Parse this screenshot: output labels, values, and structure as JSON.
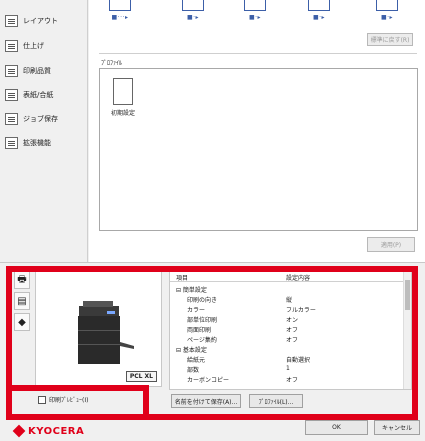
{
  "sidebar": {
    "items": [
      {
        "label": "レイアウト",
        "icon": "layout-icon"
      },
      {
        "label": "仕上げ",
        "icon": "finishing-icon"
      },
      {
        "label": "印刷品質",
        "icon": "print-quality-icon"
      },
      {
        "label": "表紙/合紙",
        "icon": "cover-icon"
      },
      {
        "label": "ジョブ保存",
        "icon": "job-storage-icon"
      },
      {
        "label": "拡張機能",
        "icon": "extension-icon"
      }
    ]
  },
  "top": {
    "layout_dots": [
      "■···▸",
      "■·▸",
      "■·▸",
      "■·▸",
      "■·▸"
    ],
    "restore_default": "標準に戻す(R)",
    "profile_label": "ﾌﾟﾛﾌｧｲﾙ",
    "profile_item": "初期設定",
    "apply": "適用(P)"
  },
  "preview": {
    "model_badge": "PCL XL",
    "checkbox_label": "印刷ﾌﾟﾚﾋﾞｭｰ(I)"
  },
  "settings_table": {
    "header": {
      "item": "項目",
      "value": "設定内容"
    },
    "rows": [
      {
        "item": "⊟ 簡単設定",
        "value": ""
      },
      {
        "item": "印刷の向き",
        "value": "縦"
      },
      {
        "item": "カラー",
        "value": "フルカラー"
      },
      {
        "item": "部単位印刷",
        "value": "オン"
      },
      {
        "item": "両面印刷",
        "value": "オフ"
      },
      {
        "item": "ページ集約",
        "value": "オフ"
      },
      {
        "item": "⊟ 基本設定",
        "value": ""
      },
      {
        "item": "給紙元",
        "value": "自動選択"
      },
      {
        "item": "部数",
        "value": "1"
      },
      {
        "item": "カーボンコピー",
        "value": "オフ"
      }
    ]
  },
  "buttons": {
    "save_as": "名前を付けて保存(A)...",
    "profile": "ﾌﾟﾛﾌｧｲﾙ(L)...",
    "ok": "OK",
    "cancel": "キャンセル"
  },
  "brand": {
    "name": "KYOCERA",
    "accent": "#e0001a"
  }
}
